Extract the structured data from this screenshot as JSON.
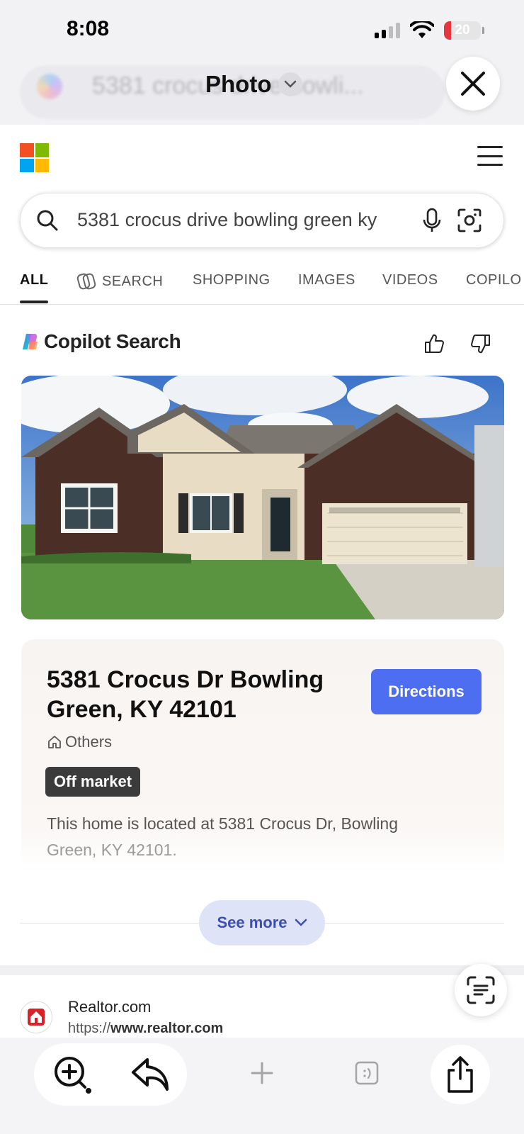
{
  "status_bar": {
    "time": "8:08",
    "battery": "20",
    "battery_level_percent": 20
  },
  "photo_header": {
    "title": "Photo",
    "background_query": "5381 crocus drive bowli..."
  },
  "search": {
    "query": "5381 crocus drive bowling green ky"
  },
  "tabs": [
    {
      "label": "ALL"
    },
    {
      "label": "SEARCH"
    },
    {
      "label": "SHOPPING"
    },
    {
      "label": "IMAGES"
    },
    {
      "label": "VIDEOS"
    },
    {
      "label": "COPILO"
    }
  ],
  "copilot": {
    "title": "Copilot Search"
  },
  "listing": {
    "address_line": "5381 Crocus Dr Bowling Green, KY 42101",
    "directions_label": "Directions",
    "category": "Others",
    "status_badge": "Off market",
    "description_main": "This home is located at 5381 Crocus Dr, Bowling",
    "description_faded": "Green, KY 42101."
  },
  "see_more_label": "See more",
  "result": {
    "site": "Realtor.com",
    "url_prefix": "https://",
    "url_domain": "www.realtor.com"
  },
  "colors": {
    "accent": "#4e6ef2",
    "badge": "#3b3b3b",
    "see_more_bg": "#dfe3f8"
  }
}
